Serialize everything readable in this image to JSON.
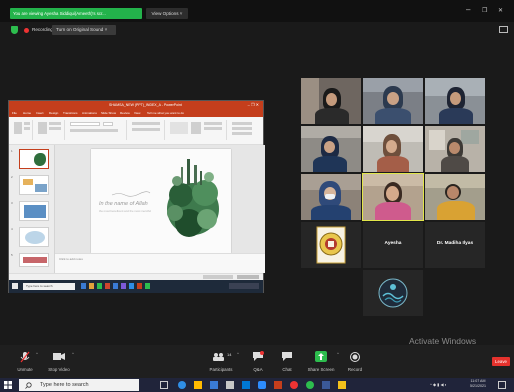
{
  "topbar": {
    "banner_text": "You are viewing Ayesha Siddiqui(Ameeth)'s scr... ",
    "view_options_label": "View Options ˅",
    "minimize": "–",
    "restore": "❐",
    "close": "✕"
  },
  "recording": {
    "label": "Recording",
    "original_sound_label": "Turn on Original Sound  ˅"
  },
  "shared_screen": {
    "ppt_title": "SHAMSA_NEW (PPT)_INDEX_A - PowerPoint",
    "tabs": [
      "File",
      "Home",
      "Insert",
      "Design",
      "Transitions",
      "Animations",
      "Slide Show",
      "Review",
      "View",
      "Tell me what you want to do"
    ],
    "slide_text": "In the name of Allah",
    "slide_subtext": "the most beneficent and the most merciful",
    "notes_label": "Click to add notes",
    "mini_search_placeholder": "Type here to search",
    "thumb_numbers": [
      "1",
      "2",
      "3",
      "4",
      "5"
    ]
  },
  "participants": [
    {
      "name": "",
      "bg": "#6e6660"
    },
    {
      "name": "",
      "bg": "#7b7f86"
    },
    {
      "name": "",
      "bg": "#8a9096"
    },
    {
      "name": "",
      "bg": "#8e8b86"
    },
    {
      "name": "",
      "bg": "#b8b2a8"
    },
    {
      "name": "",
      "bg": "#bfbcb5"
    },
    {
      "name": "",
      "bg": "#8c8278"
    },
    {
      "name": "",
      "bg": "#b3a28e"
    },
    {
      "name": "",
      "bg": "#a39e8c"
    },
    {
      "name": "",
      "bg": "#262626"
    },
    {
      "name": "Ayesha",
      "bg": "#262626"
    },
    {
      "name": "Dr. Madiha Ilyas",
      "bg": "#262626"
    },
    {
      "name": "",
      "bg": "#262626"
    }
  ],
  "toolbar": {
    "unmute": "Unmute",
    "stop_video": "Stop Video",
    "participants": "Participants",
    "participants_count": "14",
    "qa": "Q&A",
    "chat": "Chat",
    "share_screen": "Share Screen",
    "record": "Record",
    "leave": "Leave"
  },
  "watermark": {
    "title": "Activate Windows",
    "subtitle": "Go to Settings to activate Windows."
  },
  "taskbar": {
    "search_placeholder": "Type here to search",
    "time": "11:07 AM",
    "date": "5/21/2021"
  },
  "colors": {
    "banner_green": "#23b34b",
    "share_green": "#2dbd4e",
    "leave_red": "#e5322d",
    "ppt_orange": "#c43e1c",
    "active_outline": "#e2e64a"
  }
}
